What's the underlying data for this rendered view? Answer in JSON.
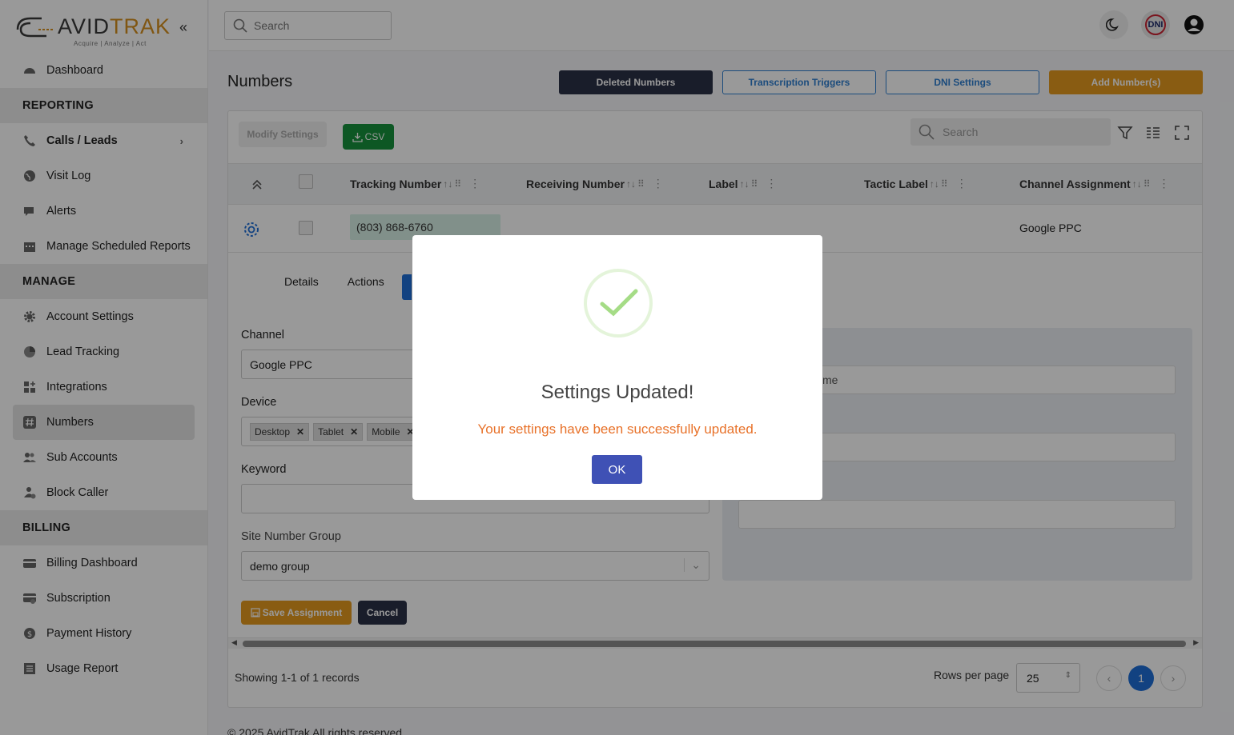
{
  "brand": {
    "name_a": "AVID",
    "name_b": "TRAK",
    "tagline": "Acquire  |  Analyze  |  Act",
    "accent_color": "#d6901e"
  },
  "sidebar": {
    "collapse_icon": "chevrons-left-icon",
    "items": [
      {
        "type": "item",
        "label": "Dashboard",
        "icon": "dashboard-icon"
      },
      {
        "type": "header",
        "label": "REPORTING"
      },
      {
        "type": "item",
        "label": "Calls / Leads",
        "icon": "phone-icon",
        "bold": true,
        "chevron": true
      },
      {
        "type": "item",
        "label": "Visit Log",
        "icon": "globe-icon"
      },
      {
        "type": "item",
        "label": "Alerts",
        "icon": "chat-icon"
      },
      {
        "type": "item",
        "label": "Manage Scheduled Reports",
        "icon": "calendar-icon"
      },
      {
        "type": "header",
        "label": "MANAGE"
      },
      {
        "type": "item",
        "label": "Account Settings",
        "icon": "gear-icon"
      },
      {
        "type": "item",
        "label": "Lead Tracking",
        "icon": "pie-chart-icon"
      },
      {
        "type": "item",
        "label": "Integrations",
        "icon": "grid-icon"
      },
      {
        "type": "item",
        "label": "Numbers",
        "icon": "hash-icon",
        "active": true
      },
      {
        "type": "item",
        "label": "Sub Accounts",
        "icon": "users-icon"
      },
      {
        "type": "item",
        "label": "Block Caller",
        "icon": "user-block-icon"
      },
      {
        "type": "header",
        "label": "BILLING"
      },
      {
        "type": "item",
        "label": "Billing Dashboard",
        "icon": "card-icon"
      },
      {
        "type": "item",
        "label": "Subscription",
        "icon": "card-refresh-icon"
      },
      {
        "type": "item",
        "label": "Payment History",
        "icon": "dollar-icon"
      },
      {
        "type": "item",
        "label": "Usage Report",
        "icon": "list-icon"
      }
    ]
  },
  "topbar": {
    "search_placeholder": "Search",
    "dni_label": "DNI"
  },
  "page": {
    "title": "Numbers",
    "buttons": {
      "deleted": "Deleted Numbers",
      "transcription": "Transcription Triggers",
      "dni": "DNI Settings",
      "add": "Add Number(s)"
    }
  },
  "table": {
    "toolbar": {
      "modify": "Modify Settings",
      "csv": "CSV",
      "search_placeholder": "Search"
    },
    "columns": [
      "Tracking Number",
      "Receiving Number",
      "Label",
      "Tactic Label",
      "Channel Assignment"
    ],
    "rows": [
      {
        "tracking": "(803) 868-6760",
        "receiving": "",
        "label": "",
        "tactic": "",
        "channel": "Google PPC"
      }
    ],
    "detail_tabs": [
      "Details",
      "Actions"
    ],
    "form": {
      "channel_label": "Channel",
      "channel_value": "Google PPC",
      "device_label": "Device",
      "devices": [
        "Desktop",
        "Tablet",
        "Mobile"
      ],
      "keyword_label": "Keyword",
      "site_group_label": "Site Number Group",
      "site_group_value": "demo group",
      "right_panel_placeholder": "me",
      "save": "Save Assignment",
      "cancel": "Cancel"
    },
    "footer": {
      "showing": "Showing 1-1 of 1 records",
      "rows_per_page_label": "Rows per page",
      "rows_per_page": "25",
      "page": "1"
    }
  },
  "copyright": "© 2025 AvidTrak All rights reserved",
  "modal": {
    "title": "Settings Updated!",
    "message": "Your settings have been successfully updated.",
    "ok": "OK",
    "success_color": "#a5dc86"
  }
}
